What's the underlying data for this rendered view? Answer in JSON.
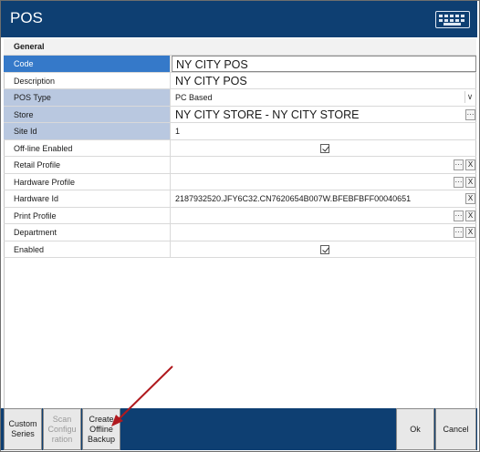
{
  "window": {
    "title": "POS",
    "keyboard_icon": "keyboard-icon"
  },
  "section": {
    "title": "General"
  },
  "fields": {
    "code": {
      "label": "Code",
      "value": "NY CITY POS"
    },
    "description": {
      "label": "Description",
      "value": "NY CITY POS"
    },
    "pos_type": {
      "label": "POS Type",
      "value": "PC Based"
    },
    "store": {
      "label": "Store",
      "value": "NY CITY STORE - NY CITY STORE"
    },
    "site_id": {
      "label": "Site Id",
      "value": "1"
    },
    "offline_enabled": {
      "label": "Off-line Enabled",
      "checked": true
    },
    "retail_profile": {
      "label": "Retail Profile",
      "value": ""
    },
    "hardware_profile": {
      "label": "Hardware Profile",
      "value": ""
    },
    "hardware_id": {
      "label": "Hardware Id",
      "value": "2187932520.JFY6C32.CN7620654B007W.BFEBFBFF00040651"
    },
    "print_profile": {
      "label": "Print Profile",
      "value": ""
    },
    "department": {
      "label": "Department",
      "value": ""
    },
    "enabled": {
      "label": "Enabled",
      "checked": true
    }
  },
  "row_buttons": {
    "lookup": "···",
    "clear": "X",
    "dropdown": "∨"
  },
  "footer": {
    "custom_series": "Custom\nSeries",
    "scan_configuration": "Scan\nConfigu\nration",
    "create_offline_backup": "Create\nOffline\nBackup",
    "ok": "Ok",
    "cancel": "Cancel"
  },
  "colors": {
    "titlebar": "#0e3f72",
    "selected_label": "#3579c9",
    "mandatory_label": "#b9c8e0",
    "annotation_arrow": "#b0191e"
  }
}
